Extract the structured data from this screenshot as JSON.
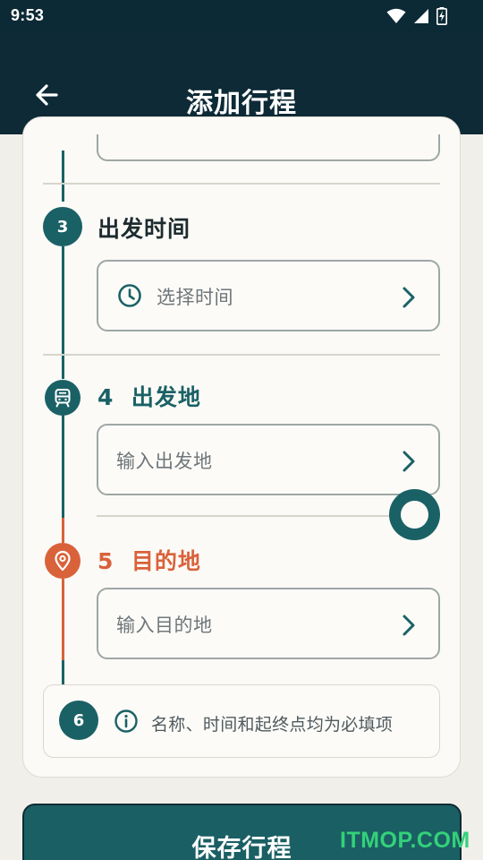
{
  "status_bar": {
    "time": "9:53"
  },
  "header": {
    "title": "添加行程"
  },
  "steps": {
    "time": {
      "number": "3",
      "title": "出发时间",
      "field_placeholder": "选择时间"
    },
    "origin": {
      "number": "4",
      "title": "出发地",
      "field_placeholder": "输入出发地"
    },
    "destination": {
      "number": "5",
      "title": "目的地",
      "field_placeholder": "输入目的地"
    },
    "note": {
      "number": "6",
      "text": "名称、时间和起终点均为必填项"
    }
  },
  "footer": {
    "save_label": "保存行程"
  },
  "watermark": "ITMOP.COM",
  "colors": {
    "header_bg": "#0d2a36",
    "teal": "#1a6166",
    "orange": "#d9623b",
    "page_bg": "#f1efea",
    "card_bg": "#fbfaf6"
  }
}
